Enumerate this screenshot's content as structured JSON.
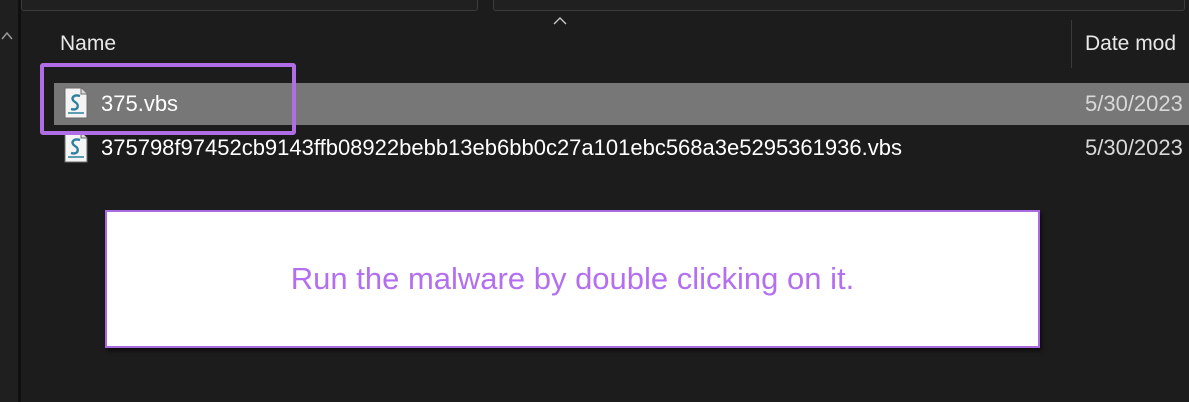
{
  "explorer": {
    "columns": {
      "name": "Name",
      "date": "Date mod"
    },
    "files": [
      {
        "name": "375.vbs",
        "date": "5/30/2023",
        "icon": "vbs-script-icon",
        "selected": true
      },
      {
        "name": "375798f97452cb9143ffb08922bebb13eb6bb0c27a101ebc568a3e5295361936.vbs",
        "date": "5/30/2023",
        "icon": "vbs-script-icon",
        "selected": false
      }
    ]
  },
  "annotation": {
    "callout_text": "Run the malware by double clicking on it.",
    "highlight_color": "#b06de6"
  },
  "colors": {
    "background": "#1c1c1c",
    "selected_row": "#777777",
    "callout_text": "#b46ff0"
  }
}
